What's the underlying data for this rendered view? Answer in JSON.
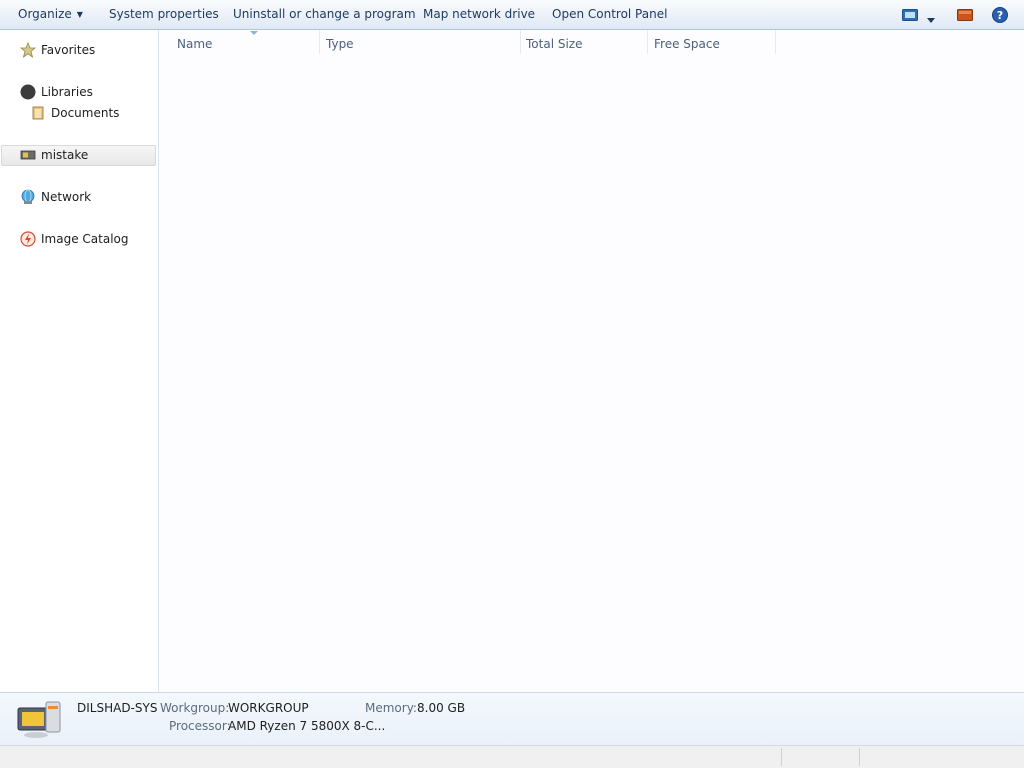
{
  "toolbar": {
    "organize_label": "Organize",
    "items": [
      "System properties",
      "Uninstall or change a program",
      "Map network drive",
      "Open Control Panel"
    ],
    "icons": [
      "change-view-icon",
      "view-options-dropdown-icon",
      "preview-pane-icon",
      "help-icon"
    ]
  },
  "nav": {
    "favorites": "Favorites",
    "libraries": "Libraries",
    "documents": "Documents",
    "computer": "mistake",
    "network": "Network",
    "image_catalog": "Image Catalog"
  },
  "columns": [
    "Name",
    "Type",
    "Total Size",
    "Free Space"
  ],
  "details": {
    "computer_name": "DILSHAD-SYS",
    "workgroup_label": "Workgroup:",
    "workgroup_value": "WORKGROUP",
    "memory_label": "Memory:",
    "memory_value": "8.00 GB",
    "processor_label": "Processor:",
    "processor_value": "AMD Ryzen 7 5800X 8-C..."
  },
  "colors": {
    "toolbar_top": "#fafcfe",
    "toolbar_bottom": "#dfe8f5",
    "text": "#1e395b",
    "details_bg": "#eaf1fa"
  }
}
